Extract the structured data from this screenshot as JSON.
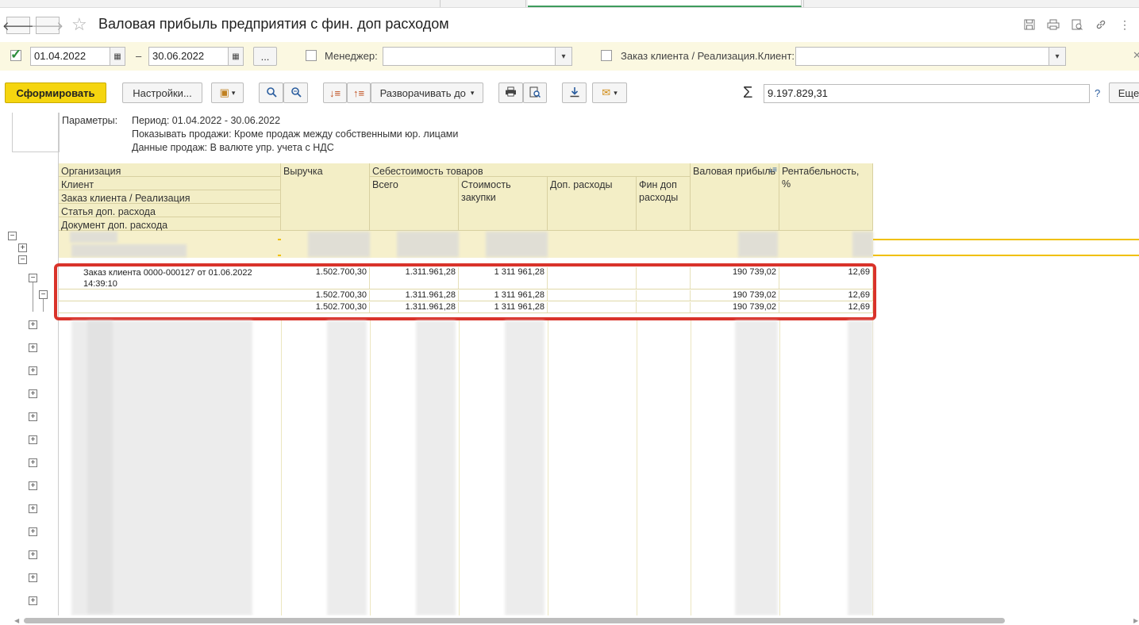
{
  "window": {
    "title": "Валовая прибыль предприятия с фин. доп расходом"
  },
  "filters": {
    "date_from": "01.04.2022",
    "date_to": "30.06.2022",
    "dash": "–",
    "more": "...",
    "manager_label": "Менеджер:",
    "manager_value": "",
    "client_label": "Заказ клиента / Реализация.Клиент:",
    "client_value": "",
    "period_checked": true
  },
  "toolbar": {
    "generate": "Сформировать",
    "settings": "Настройки...",
    "expand_to": "Разворачивать до",
    "sum_value": "9.197.829,31",
    "help": "?",
    "more": "Еще"
  },
  "params": {
    "label": "Параметры:",
    "lines": [
      "Период: 01.04.2022 - 30.06.2022",
      "Показывать продажи: Кроме продаж между собственными юр. лицами",
      "Данные продаж: В валюте упр. учета с НДС"
    ]
  },
  "table": {
    "group_headers": [
      "Организация",
      "Клиент",
      "Заказ клиента / Реализация",
      "Статья доп. расхода",
      "Документ доп. расхода"
    ],
    "col_revenue": "Выручка",
    "col_cost": "Себестоимость товаров",
    "col_total": "Всего",
    "col_purchase": "Стоимость закупки",
    "col_extra": "Доп. расходы",
    "col_fin": "Фин доп расходы",
    "col_gross": "Валовая прибыль",
    "col_profit": "Рентабельность, %",
    "rows": [
      {
        "name": "Заказ клиента 0000-000127 от 01.06.2022 14:39:10",
        "revenue": "1.502.700,30",
        "total": "1.311.961,28",
        "purchase": "1 311 961,28",
        "extra": "",
        "fin": "",
        "gross": "190 739,02",
        "profit": "12,69"
      },
      {
        "name": "",
        "revenue": "1.502.700,30",
        "total": "1.311.961,28",
        "purchase": "1 311 961,28",
        "extra": "",
        "fin": "",
        "gross": "190 739,02",
        "profit": "12,69"
      },
      {
        "name": "",
        "revenue": "1.502.700,30",
        "total": "1.311.961,28",
        "purchase": "1 311 961,28",
        "extra": "",
        "fin": "",
        "gross": "190 739,02",
        "profit": "12,69"
      }
    ]
  },
  "colors": {
    "accent_yellow": "#f5d50f",
    "highlight_red": "#d9332a",
    "header_bg": "#f3eec6",
    "filter_bg": "#fbf8e1"
  }
}
